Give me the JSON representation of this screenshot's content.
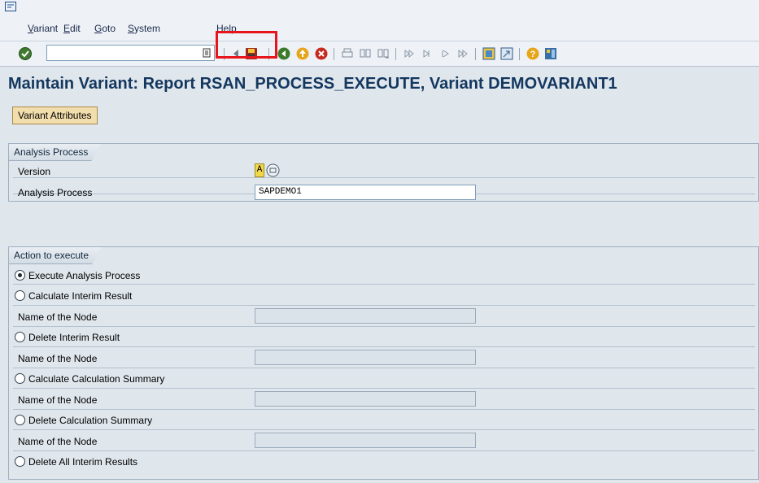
{
  "menu": {
    "items": [
      "Variant",
      "Edit",
      "Goto",
      "System",
      "Help"
    ]
  },
  "toolbar": {
    "command_field_value": ""
  },
  "page": {
    "title": "Maintain Variant: Report RSAN_PROCESS_EXECUTE, Variant DEMOVARIANT1"
  },
  "actions": {
    "variant_attributes": "Variant Attributes"
  },
  "analysis": {
    "header": "Analysis Process",
    "version_label": "Version",
    "version_value": "A",
    "process_label": "Analysis Process",
    "process_value": "SAPDEMO1"
  },
  "execute": {
    "header": "Action to execute",
    "options": [
      {
        "label": "Execute Analysis Process",
        "checked": true
      },
      {
        "label": "Calculate Interim Result",
        "checked": false
      },
      {
        "label": "Delete Interim Result",
        "checked": false
      },
      {
        "label": "Calculate Calculation Summary",
        "checked": false
      },
      {
        "label": "Delete Calculation Summary",
        "checked": false
      },
      {
        "label": "Delete All Interim Results",
        "checked": false
      }
    ],
    "node_label": "Name of the Node"
  },
  "colors": {
    "title": "#14375f",
    "highlight": "#e8141c",
    "button": "#f2ddac"
  }
}
